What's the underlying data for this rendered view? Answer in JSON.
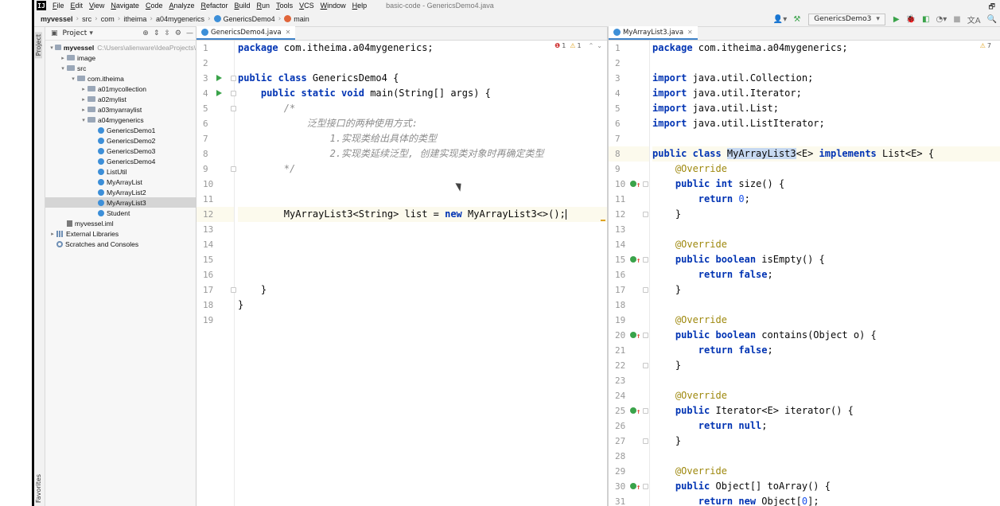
{
  "menubar": {
    "logo": "IJ",
    "items": [
      {
        "first": "F",
        "rest": "ile"
      },
      {
        "first": "E",
        "rest": "dit"
      },
      {
        "first": "V",
        "rest": "iew"
      },
      {
        "first": "N",
        "rest": "avigate"
      },
      {
        "first": "C",
        "rest": "ode"
      },
      {
        "first": "A",
        "rest": "nalyze"
      },
      {
        "first": "R",
        "rest": "efactor"
      },
      {
        "first": "B",
        "rest": "uild"
      },
      {
        "first": "R",
        "rest": "un"
      },
      {
        "first": "T",
        "rest": "ools"
      },
      {
        "first": "V",
        "rest": "CS"
      },
      {
        "first": "W",
        "rest": "indow"
      },
      {
        "first": "H",
        "rest": "elp"
      }
    ],
    "window_title": "basic-code - GenericsDemo4.java"
  },
  "navbar": {
    "breadcrumbs": [
      "myvessel",
      "src",
      "com",
      "itheima",
      "a04mygenerics",
      "GenericsDemo4",
      "main"
    ],
    "run_config": "GenericsDemo3"
  },
  "tool_strip": {
    "project_tab": "Project",
    "favorites_tab": "Favorites"
  },
  "project_panel": {
    "title": "Project",
    "tree": [
      {
        "label": "myvessel",
        "path": "C:\\Users\\alienware\\IdeaProjects\\",
        "bold": true,
        "level": 0,
        "arrow": "▾",
        "icon": "folder"
      },
      {
        "label": "image",
        "level": 1,
        "arrow": "▸",
        "icon": "folder"
      },
      {
        "label": "src",
        "level": 1,
        "arrow": "▾",
        "icon": "folder"
      },
      {
        "label": "com.itheima",
        "level": 2,
        "arrow": "▾",
        "icon": "folder"
      },
      {
        "label": "a01mycollection",
        "level": 3,
        "arrow": "▸",
        "icon": "folder"
      },
      {
        "label": "a02mylist",
        "level": 3,
        "arrow": "▸",
        "icon": "folder"
      },
      {
        "label": "a03myarraylist",
        "level": 3,
        "arrow": "▸",
        "icon": "folder"
      },
      {
        "label": "a04mygenerics",
        "level": 3,
        "arrow": "▾",
        "icon": "folder"
      },
      {
        "label": "GenericsDemo1",
        "level": 4,
        "arrow": "",
        "icon": "class"
      },
      {
        "label": "GenericsDemo2",
        "level": 4,
        "arrow": "",
        "icon": "class"
      },
      {
        "label": "GenericsDemo3",
        "level": 4,
        "arrow": "",
        "icon": "class"
      },
      {
        "label": "GenericsDemo4",
        "level": 4,
        "arrow": "",
        "icon": "class"
      },
      {
        "label": "ListUtil",
        "level": 4,
        "arrow": "",
        "icon": "class"
      },
      {
        "label": "MyArrayList",
        "level": 4,
        "arrow": "",
        "icon": "class"
      },
      {
        "label": "MyArrayList2",
        "level": 4,
        "arrow": "",
        "icon": "class"
      },
      {
        "label": "MyArrayList3",
        "level": 4,
        "arrow": "",
        "icon": "class",
        "selected": true
      },
      {
        "label": "Student",
        "level": 4,
        "arrow": "",
        "icon": "class"
      },
      {
        "label": "myvessel.iml",
        "level": 1,
        "arrow": "",
        "icon": "iml"
      },
      {
        "label": "External Libraries",
        "level": 0,
        "arrow": "▸",
        "icon": "lib"
      },
      {
        "label": "Scratches and Consoles",
        "level": 0,
        "arrow": "",
        "icon": "scratch"
      }
    ]
  },
  "editor_left": {
    "tab": "GenericsDemo4.java",
    "inspection": {
      "errors": "1",
      "warnings": "1"
    },
    "lines": [
      {
        "n": "1",
        "code": [
          {
            "t": "package ",
            "c": "kw"
          },
          {
            "t": "com.itheima.a04mygenerics;"
          }
        ]
      },
      {
        "n": "2",
        "code": []
      },
      {
        "n": "3",
        "run": true,
        "fold": true,
        "code": [
          {
            "t": "public class ",
            "c": "kw"
          },
          {
            "t": "GenericsDemo4 {"
          }
        ]
      },
      {
        "n": "4",
        "run": true,
        "fold": true,
        "code": [
          {
            "t": "    "
          },
          {
            "t": "public static void ",
            "c": "kw"
          },
          {
            "t": "main(String[] args) {"
          }
        ]
      },
      {
        "n": "5",
        "fold": true,
        "code": [
          {
            "t": "        /*",
            "c": "cm"
          }
        ]
      },
      {
        "n": "6",
        "code": [
          {
            "t": "            泛型接口的两种使用方式:",
            "c": "cm"
          }
        ]
      },
      {
        "n": "7",
        "code": [
          {
            "t": "                1.实现类给出具体的类型",
            "c": "cm"
          }
        ]
      },
      {
        "n": "8",
        "code": [
          {
            "t": "                2.实现类延续泛型, 创建实现类对象时再确定类型",
            "c": "cm"
          }
        ]
      },
      {
        "n": "9",
        "fold": true,
        "code": [
          {
            "t": "        */",
            "c": "cm"
          }
        ]
      },
      {
        "n": "10",
        "code": []
      },
      {
        "n": "11",
        "code": []
      },
      {
        "n": "12",
        "current": true,
        "caret": true,
        "code": [
          {
            "t": "        MyArrayList3<String> list = "
          },
          {
            "t": "new ",
            "c": "kw"
          },
          {
            "t": "MyArrayList3<>();"
          }
        ]
      },
      {
        "n": "13",
        "code": []
      },
      {
        "n": "14",
        "code": []
      },
      {
        "n": "15",
        "code": []
      },
      {
        "n": "16",
        "code": []
      },
      {
        "n": "17",
        "fold": true,
        "code": [
          {
            "t": "    }"
          }
        ]
      },
      {
        "n": "18",
        "code": [
          {
            "t": "}"
          }
        ]
      },
      {
        "n": "19",
        "code": []
      }
    ]
  },
  "editor_right": {
    "tab": "MyArrayList3.java",
    "inspection": {
      "warnings": "7"
    },
    "lines": [
      {
        "n": "1",
        "code": [
          {
            "t": "package ",
            "c": "kw"
          },
          {
            "t": "com.itheima.a04mygenerics;"
          }
        ]
      },
      {
        "n": "2",
        "code": []
      },
      {
        "n": "3",
        "code": [
          {
            "t": "import ",
            "c": "kw"
          },
          {
            "t": "java.util.Collection;"
          }
        ]
      },
      {
        "n": "4",
        "code": [
          {
            "t": "import ",
            "c": "kw"
          },
          {
            "t": "java.util.Iterator;"
          }
        ]
      },
      {
        "n": "5",
        "code": [
          {
            "t": "import ",
            "c": "kw"
          },
          {
            "t": "java.util.List;"
          }
        ]
      },
      {
        "n": "6",
        "code": [
          {
            "t": "import ",
            "c": "kw"
          },
          {
            "t": "java.util.ListIterator;"
          }
        ]
      },
      {
        "n": "7",
        "code": []
      },
      {
        "n": "8",
        "current": true,
        "code": [
          {
            "t": "public class ",
            "c": "kw"
          },
          {
            "t": "MyArrayList3",
            "c": "hl"
          },
          {
            "t": "<E> "
          },
          {
            "t": "implements ",
            "c": "kw"
          },
          {
            "t": "List<E> {"
          }
        ]
      },
      {
        "n": "9",
        "code": [
          {
            "t": "    "
          },
          {
            "t": "@Override",
            "c": "ann"
          }
        ]
      },
      {
        "n": "10",
        "impl": true,
        "fold": true,
        "code": [
          {
            "t": "    "
          },
          {
            "t": "public int ",
            "c": "kw"
          },
          {
            "t": "size() {"
          }
        ]
      },
      {
        "n": "11",
        "code": [
          {
            "t": "        "
          },
          {
            "t": "return ",
            "c": "kw"
          },
          {
            "t": "0",
            "c": "num-lit"
          },
          {
            "t": ";"
          }
        ]
      },
      {
        "n": "12",
        "fold": true,
        "code": [
          {
            "t": "    }"
          }
        ]
      },
      {
        "n": "13",
        "code": []
      },
      {
        "n": "14",
        "code": [
          {
            "t": "    "
          },
          {
            "t": "@Override",
            "c": "ann"
          }
        ]
      },
      {
        "n": "15",
        "impl": true,
        "fold": true,
        "code": [
          {
            "t": "    "
          },
          {
            "t": "public boolean ",
            "c": "kw"
          },
          {
            "t": "isEmpty() {"
          }
        ]
      },
      {
        "n": "16",
        "code": [
          {
            "t": "        "
          },
          {
            "t": "return false",
            "c": "kw"
          },
          {
            "t": ";"
          }
        ]
      },
      {
        "n": "17",
        "fold": true,
        "code": [
          {
            "t": "    }"
          }
        ]
      },
      {
        "n": "18",
        "code": []
      },
      {
        "n": "19",
        "code": [
          {
            "t": "    "
          },
          {
            "t": "@Override",
            "c": "ann"
          }
        ]
      },
      {
        "n": "20",
        "impl": true,
        "fold": true,
        "code": [
          {
            "t": "    "
          },
          {
            "t": "public boolean ",
            "c": "kw"
          },
          {
            "t": "contains(Object o) {"
          }
        ]
      },
      {
        "n": "21",
        "code": [
          {
            "t": "        "
          },
          {
            "t": "return false",
            "c": "kw"
          },
          {
            "t": ";"
          }
        ]
      },
      {
        "n": "22",
        "fold": true,
        "code": [
          {
            "t": "    }"
          }
        ]
      },
      {
        "n": "23",
        "code": []
      },
      {
        "n": "24",
        "code": [
          {
            "t": "    "
          },
          {
            "t": "@Override",
            "c": "ann"
          }
        ]
      },
      {
        "n": "25",
        "impl": true,
        "fold": true,
        "code": [
          {
            "t": "    "
          },
          {
            "t": "public ",
            "c": "kw"
          },
          {
            "t": "Iterator<E> iterator() {"
          }
        ]
      },
      {
        "n": "26",
        "code": [
          {
            "t": "        "
          },
          {
            "t": "return null",
            "c": "kw"
          },
          {
            "t": ";"
          }
        ]
      },
      {
        "n": "27",
        "fold": true,
        "code": [
          {
            "t": "    }"
          }
        ]
      },
      {
        "n": "28",
        "code": []
      },
      {
        "n": "29",
        "code": [
          {
            "t": "    "
          },
          {
            "t": "@Override",
            "c": "ann"
          }
        ]
      },
      {
        "n": "30",
        "impl": true,
        "fold": true,
        "code": [
          {
            "t": "    "
          },
          {
            "t": "public ",
            "c": "kw"
          },
          {
            "t": "Object[] toArray() {"
          }
        ]
      },
      {
        "n": "31",
        "code": [
          {
            "t": "        "
          },
          {
            "t": "return new ",
            "c": "kw"
          },
          {
            "t": "Object["
          },
          {
            "t": "0",
            "c": "num-lit"
          },
          {
            "t": "];"
          }
        ]
      }
    ]
  },
  "colors": {
    "keyword": "#0033b3",
    "comment": "#8c8c8c",
    "annotation": "#9e880d",
    "number": "#1750eb",
    "selection": "#c7d9f1",
    "current_line": "#fcfaed",
    "run_icon": "#3aa34a",
    "tab_accent": "#4083c9"
  }
}
